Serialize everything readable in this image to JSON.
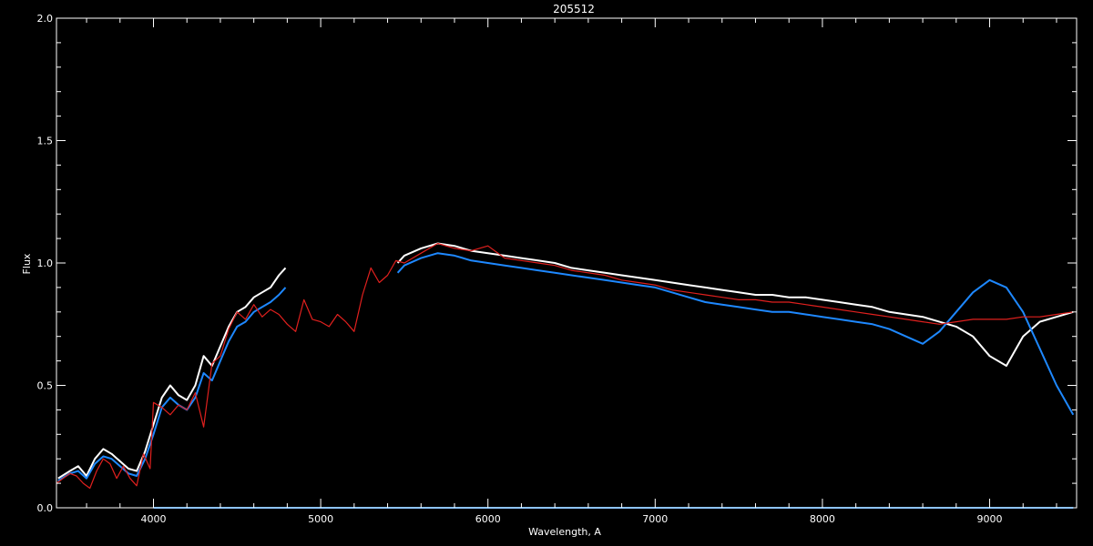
{
  "chart_data": {
    "type": "line",
    "title": "205512",
    "xlabel": "Wavelength, A",
    "ylabel": "Flux",
    "xlim": [
      3420,
      9520
    ],
    "ylim": [
      0.0,
      2.0
    ],
    "x_ticks": [
      4000,
      5000,
      6000,
      7000,
      8000,
      9000
    ],
    "y_ticks": [
      0.0,
      0.5,
      1.0,
      1.5,
      2.0
    ],
    "y_tick_labels": [
      "0.0",
      "0.5",
      "1.0",
      "1.5",
      "2.0"
    ],
    "grid": false,
    "series": [
      {
        "color": "#ffffff",
        "segments": [
          {
            "x": [
              3430,
              3500,
              3550,
              3600,
              3650,
              3700,
              3750,
              3800,
              3850,
              3900,
              3950,
              4000,
              4050,
              4100,
              4150,
              4200,
              4250,
              4300,
              4350,
              4400,
              4450,
              4500,
              4550,
              4600,
              4650,
              4700,
              4750,
              4790
            ],
            "y": [
              0.12,
              0.15,
              0.17,
              0.13,
              0.2,
              0.24,
              0.22,
              0.19,
              0.16,
              0.15,
              0.23,
              0.34,
              0.45,
              0.5,
              0.46,
              0.44,
              0.5,
              0.62,
              0.58,
              0.66,
              0.74,
              0.8,
              0.82,
              0.86,
              0.88,
              0.9,
              0.95,
              0.98
            ]
          },
          {
            "x": [
              5460,
              5500,
              5600,
              5700,
              5800,
              5900,
              6000,
              6100,
              6200,
              6300,
              6400,
              6500,
              6600,
              6700,
              6800,
              6900,
              7000,
              7100,
              7200,
              7300,
              7400,
              7500,
              7600,
              7700,
              7800,
              7900,
              8000,
              8100,
              8200,
              8300,
              8400,
              8500,
              8600,
              8700,
              8800,
              8900,
              9000,
              9100,
              9200,
              9300,
              9400,
              9500
            ],
            "y": [
              1.0,
              1.03,
              1.06,
              1.08,
              1.07,
              1.05,
              1.04,
              1.03,
              1.02,
              1.01,
              1.0,
              0.98,
              0.97,
              0.96,
              0.95,
              0.94,
              0.93,
              0.92,
              0.91,
              0.9,
              0.89,
              0.88,
              0.87,
              0.87,
              0.86,
              0.86,
              0.85,
              0.84,
              0.83,
              0.82,
              0.8,
              0.79,
              0.78,
              0.76,
              0.74,
              0.7,
              0.62,
              0.58,
              0.7,
              0.76,
              0.78,
              0.8
            ]
          }
        ]
      },
      {
        "color": "#1e88ff",
        "segments": [
          {
            "x": [
              3430,
              3500,
              3550,
              3600,
              3650,
              3700,
              3750,
              3800,
              3850,
              3900,
              3950,
              4000,
              4050,
              4100,
              4150,
              4200,
              4250,
              4300,
              4350,
              4400,
              4450,
              4500,
              4550,
              4600,
              4650,
              4700,
              4750,
              4790
            ],
            "y": [
              0.11,
              0.14,
              0.15,
              0.12,
              0.18,
              0.21,
              0.2,
              0.17,
              0.14,
              0.13,
              0.2,
              0.3,
              0.41,
              0.45,
              0.42,
              0.4,
              0.45,
              0.55,
              0.52,
              0.6,
              0.68,
              0.74,
              0.76,
              0.8,
              0.82,
              0.84,
              0.87,
              0.9
            ]
          },
          {
            "x": [
              5460,
              5500,
              5600,
              5700,
              5800,
              5900,
              6000,
              6100,
              6200,
              6300,
              6400,
              6500,
              6600,
              6700,
              6800,
              6900,
              7000,
              7100,
              7200,
              7300,
              7400,
              7500,
              7600,
              7700,
              7800,
              7900,
              8000,
              8100,
              8200,
              8300,
              8400,
              8500,
              8600,
              8700,
              8800,
              8900,
              9000,
              9100,
              9200,
              9300,
              9400,
              9500
            ],
            "y": [
              0.96,
              0.99,
              1.02,
              1.04,
              1.03,
              1.01,
              1.0,
              0.99,
              0.98,
              0.97,
              0.96,
              0.95,
              0.94,
              0.93,
              0.92,
              0.91,
              0.9,
              0.88,
              0.86,
              0.84,
              0.83,
              0.82,
              0.81,
              0.8,
              0.8,
              0.79,
              0.78,
              0.77,
              0.76,
              0.75,
              0.73,
              0.7,
              0.67,
              0.72,
              0.8,
              0.88,
              0.93,
              0.9,
              0.8,
              0.65,
              0.5,
              0.38
            ]
          },
          {
            "x": [
              4000,
              9500
            ],
            "y": [
              0.0,
              0.0
            ]
          }
        ]
      },
      {
        "color": "#e0201e",
        "segments": [
          {
            "x": [
              3420,
              3460,
              3500,
              3540,
              3580,
              3620,
              3660,
              3700,
              3740,
              3780,
              3820,
              3860,
              3900,
              3940,
              3980,
              4000,
              4050,
              4100,
              4150,
              4200,
              4250,
              4300,
              4350,
              4400,
              4450,
              4500,
              4550,
              4600,
              4650,
              4700,
              4750,
              4800,
              4850,
              4900,
              4950,
              5000,
              5050,
              5100,
              5150,
              5200,
              5250,
              5300,
              5350,
              5400,
              5450,
              5500,
              5600,
              5700,
              5800,
              5900,
              6000,
              6100,
              6200,
              6300,
              6400,
              6500,
              6600,
              6700,
              6800,
              6900,
              7000,
              7100,
              7200,
              7300,
              7400,
              7500,
              7600,
              7700,
              7800,
              7900,
              8000,
              8100,
              8200,
              8300,
              8400,
              8500,
              8600,
              8700,
              8800,
              8900,
              9000,
              9100,
              9200,
              9300,
              9400,
              9500
            ],
            "y": [
              0.1,
              0.12,
              0.14,
              0.13,
              0.1,
              0.08,
              0.15,
              0.2,
              0.18,
              0.12,
              0.17,
              0.12,
              0.09,
              0.22,
              0.16,
              0.43,
              0.41,
              0.38,
              0.42,
              0.4,
              0.47,
              0.33,
              0.59,
              0.62,
              0.73,
              0.8,
              0.77,
              0.83,
              0.78,
              0.81,
              0.79,
              0.75,
              0.72,
              0.85,
              0.77,
              0.76,
              0.74,
              0.79,
              0.76,
              0.72,
              0.87,
              0.98,
              0.92,
              0.95,
              1.01,
              1.0,
              1.04,
              1.08,
              1.06,
              1.05,
              1.07,
              1.02,
              1.01,
              1.0,
              0.99,
              0.97,
              0.96,
              0.95,
              0.93,
              0.92,
              0.91,
              0.89,
              0.88,
              0.87,
              0.86,
              0.85,
              0.85,
              0.84,
              0.84,
              0.83,
              0.82,
              0.81,
              0.8,
              0.79,
              0.78,
              0.77,
              0.76,
              0.75,
              0.76,
              0.77,
              0.77,
              0.77,
              0.78,
              0.78,
              0.79,
              0.8
            ]
          }
        ]
      }
    ]
  }
}
